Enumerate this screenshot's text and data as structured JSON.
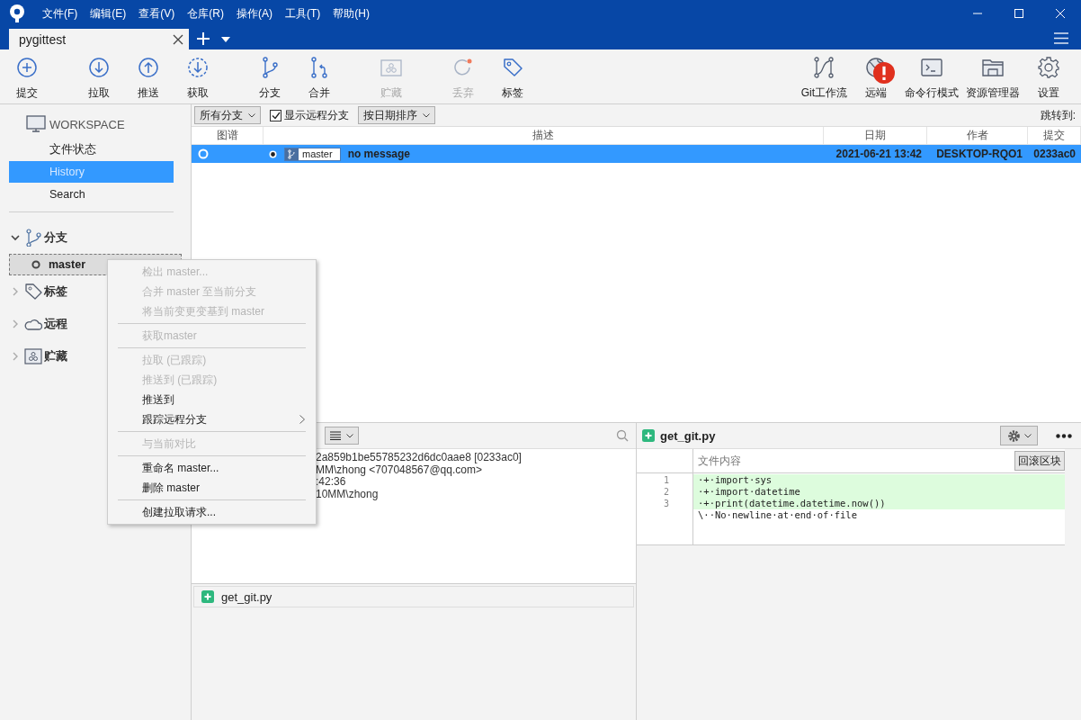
{
  "window": {
    "menu": [
      "文件(F)",
      "编辑(E)",
      "查看(V)",
      "仓库(R)",
      "操作(A)",
      "工具(T)",
      "帮助(H)"
    ]
  },
  "tabs": [
    {
      "label": "pygittest",
      "selected": true
    }
  ],
  "toolbar": {
    "left": [
      {
        "label": "提交",
        "disabled": false
      },
      {
        "label": "拉取",
        "disabled": false
      },
      {
        "label": "推送",
        "disabled": false
      },
      {
        "label": "获取",
        "disabled": false
      },
      {
        "label": "分支",
        "disabled": false
      },
      {
        "label": "合并",
        "disabled": false
      },
      {
        "label": "贮藏",
        "disabled": true
      },
      {
        "label": "丢弃",
        "disabled": true
      },
      {
        "label": "标签",
        "disabled": false
      }
    ],
    "right": [
      {
        "label": "Git工作流",
        "alert": false
      },
      {
        "label": "远端",
        "alert": true
      },
      {
        "label": "命令行模式",
        "alert": false
      },
      {
        "label": "资源管理器",
        "alert": false
      },
      {
        "label": "设置",
        "alert": false
      }
    ]
  },
  "sidebar": {
    "workspace": {
      "title": "WORKSPACE",
      "items": [
        {
          "label": "文件状态",
          "selected": false
        },
        {
          "label": "History",
          "selected": true
        },
        {
          "label": "Search",
          "selected": false
        }
      ]
    },
    "sections": [
      {
        "label": "分支",
        "expanded": true,
        "children": [
          {
            "label": "master",
            "selected": true
          }
        ]
      },
      {
        "label": "标签",
        "expanded": false
      },
      {
        "label": "远程",
        "expanded": false
      },
      {
        "label": "贮藏",
        "expanded": false
      }
    ]
  },
  "filter_bar": {
    "branch_filter": "所有分支",
    "show_remote": {
      "label": "显示远程分支",
      "checked": true
    },
    "sort": "按日期排序",
    "jump_label": "跳转到:"
  },
  "table": {
    "columns": [
      "图谱",
      "描述",
      "日期",
      "作者",
      "提交"
    ],
    "rows": [
      {
        "branch_tag": "master",
        "message": "no message",
        "date": "2021-06-21 13:42",
        "author": "DESKTOP-RQO1",
        "commit": "0233ac0",
        "selected": true
      }
    ]
  },
  "details": {
    "lines": [
      "2a859b1be55785232d6dc0aae8 [0233ac0]",
      "MM\\zhong <707048567@qq.com>",
      ":42:36",
      "10MM\\zhong"
    ],
    "files": [
      {
        "name": "get_git.py",
        "selected": false
      }
    ]
  },
  "diff": {
    "file": "get_git.py",
    "header": "文件内容",
    "revert_button": "回滚区块",
    "lines": [
      {
        "number": "1",
        "text": "·+·import·sys",
        "kind": "added"
      },
      {
        "number": "2",
        "text": "·+·import·datetime",
        "kind": "added"
      },
      {
        "number": "3",
        "text": "·+·print(datetime.datetime.now())",
        "kind": "added"
      },
      {
        "text": "\\··No·newline·at·end·of·file",
        "kind": "context"
      }
    ]
  },
  "context_menu": [
    {
      "kind": "item",
      "label": "检出 master...",
      "disabled": true,
      "submenu": false
    },
    {
      "kind": "item",
      "label": "合并 master 至当前分支",
      "disabled": true,
      "submenu": false
    },
    {
      "kind": "item",
      "label": "将当前变更变基到 master",
      "disabled": true,
      "submenu": false
    },
    {
      "kind": "separator"
    },
    {
      "kind": "item",
      "label": "获取master",
      "disabled": true,
      "submenu": false
    },
    {
      "kind": "separator"
    },
    {
      "kind": "item",
      "label": "拉取 (已跟踪)",
      "disabled": true,
      "submenu": false
    },
    {
      "kind": "item",
      "label": "推送到 (已跟踪)",
      "disabled": true,
      "submenu": false
    },
    {
      "kind": "item",
      "label": "推送到",
      "disabled": false,
      "submenu": false
    },
    {
      "kind": "item",
      "label": "跟踪远程分支",
      "disabled": false,
      "submenu": true
    },
    {
      "kind": "separator"
    },
    {
      "kind": "item",
      "label": "与当前对比",
      "disabled": true,
      "submenu": false
    },
    {
      "kind": "separator"
    },
    {
      "kind": "item",
      "label": "重命名 master...",
      "disabled": false,
      "submenu": false
    },
    {
      "kind": "item",
      "label": "删除 master",
      "disabled": false,
      "submenu": false
    },
    {
      "kind": "separator"
    },
    {
      "kind": "item",
      "label": "创建拉取请求...",
      "disabled": false,
      "submenu": false
    }
  ]
}
